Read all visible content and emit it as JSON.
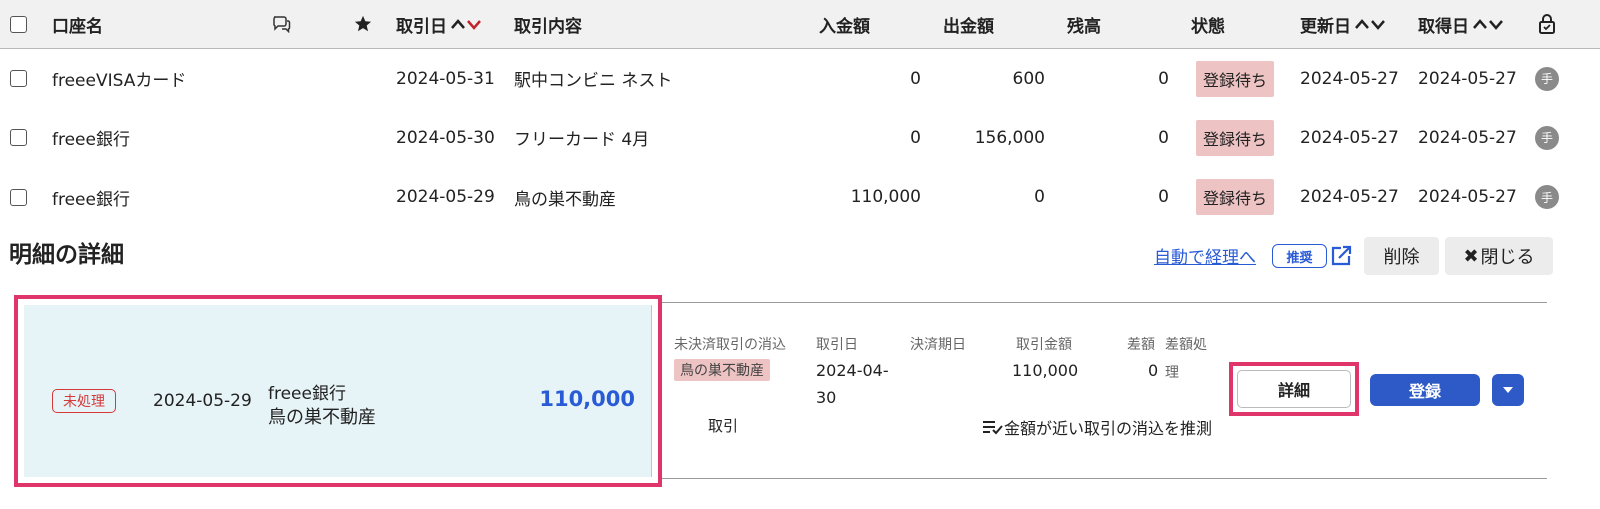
{
  "table": {
    "headers": {
      "account": "口座名",
      "date": "取引日",
      "content": "取引内容",
      "deposit": "入金額",
      "withdrawal": "出金額",
      "balance": "残高",
      "status": "状態",
      "updated": "更新日",
      "acquired": "取得日"
    },
    "rows": [
      {
        "account": "freeeVISAカード",
        "date": "2024-05-31",
        "content": "駅中コンビニ ネスト",
        "deposit": "0",
        "withdrawal": "600",
        "balance": "0",
        "status": "登録待ち",
        "updated": "2024-05-27",
        "acquired": "2024-05-27",
        "source": "手"
      },
      {
        "account": "freee銀行",
        "date": "2024-05-30",
        "content": "フリーカード 4月",
        "deposit": "0",
        "withdrawal": "156,000",
        "balance": "0",
        "status": "登録待ち",
        "updated": "2024-05-27",
        "acquired": "2024-05-27",
        "source": "手"
      },
      {
        "account": "freee銀行",
        "date": "2024-05-29",
        "content": "鳥の巣不動産",
        "deposit": "110,000",
        "withdrawal": "0",
        "balance": "0",
        "status": "登録待ち",
        "updated": "2024-05-27",
        "acquired": "2024-05-27",
        "source": "手"
      }
    ],
    "icons": {
      "comment": "comment-icon",
      "star": "star-icon",
      "sort": "sort-icon",
      "lock": "lock-icon"
    }
  },
  "detail": {
    "title": "明細の詳細",
    "auto_link": "自動で経理へ",
    "recommend_badge": "推奨",
    "delete_label": "削除",
    "close_label": "閉じる",
    "left": {
      "status": "未処理",
      "date": "2024-05-29",
      "bank": "freee銀行",
      "description": "鳥の巣不動産",
      "amount": "110,000"
    },
    "match": {
      "label_settle": "未決済取引の消込",
      "tag": "鳥の巣不動産",
      "sub_label": "取引",
      "label_date": "取引日",
      "date_line1": "2024-04-",
      "date_line2": "30",
      "label_due": "決済期日",
      "label_amount": "取引金額",
      "amount": "110,000",
      "label_diff": "差額",
      "diff": "0",
      "label_diff_proc1": "差額処",
      "label_diff_proc2": "理",
      "guess": "金額が近い取引の消込を推測"
    },
    "detail_btn": "詳細",
    "register_btn": "登録"
  },
  "colors": {
    "accent": "#2e5ac8",
    "link": "#2a5bd7",
    "highlight": "#e0356b",
    "status_bg": "#eec3c3",
    "panel_bg": "#e6f3f7"
  }
}
